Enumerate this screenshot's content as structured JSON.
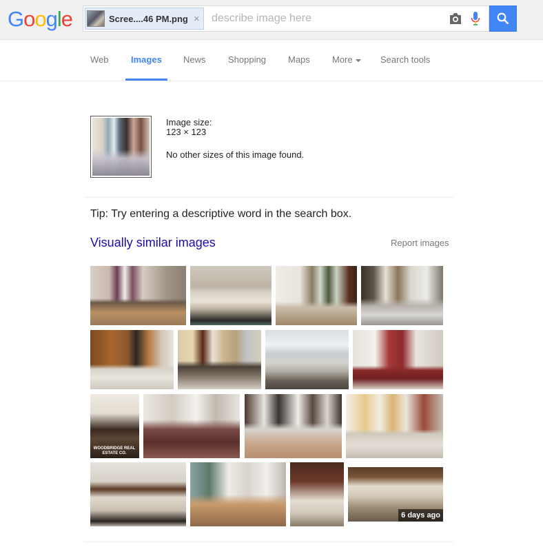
{
  "logo": {
    "text": "Google",
    "letters": [
      "G",
      "o",
      "o",
      "g",
      "l",
      "e"
    ],
    "colors": [
      "#4285f4",
      "#ea4335",
      "#fbbc05",
      "#4285f4",
      "#34a853",
      "#ea4335"
    ]
  },
  "search": {
    "chip_label": "Scree....46 PM.png",
    "chip_close": "×",
    "placeholder": "describe image here",
    "value": "",
    "camera_icon": "camera-icon",
    "mic_icon": "mic-icon",
    "search_icon": "search-icon",
    "accent": "#4285f4"
  },
  "tabs": [
    {
      "label": "Web",
      "active": false
    },
    {
      "label": "Images",
      "active": true
    },
    {
      "label": "News",
      "active": false
    },
    {
      "label": "Shopping",
      "active": false
    },
    {
      "label": "Maps",
      "active": false
    },
    {
      "label": "More",
      "active": false
    },
    {
      "label": "Search tools",
      "active": false
    }
  ],
  "query_image": {
    "size_label": "Image size:",
    "size_value": "123 × 123",
    "no_sizes": "No other sizes of this image found."
  },
  "tip": "Tip: Try entering a descriptive word in the search box.",
  "similar": {
    "title": "Visually similar images",
    "report": "Report images",
    "thumbnails": [
      {
        "desc": "dining room with purple curtains"
      },
      {
        "desc": "living room with beige sofas"
      },
      {
        "desc": "living room with wood floors"
      },
      {
        "desc": "living room with grey sofas"
      },
      {
        "desc": "wood paneled dining room"
      },
      {
        "desc": "kitchen with island and stool"
      },
      {
        "desc": "sunroom with windows"
      },
      {
        "desc": "living room with brick fireplace"
      },
      {
        "desc": "entry hall with staircase",
        "watermark": "WOODBRIDGE REAL ESTATE CO."
      },
      {
        "desc": "kitchen renovation"
      },
      {
        "desc": "kitchen with bar stools"
      },
      {
        "desc": "living room with yellow drapes"
      },
      {
        "desc": "open hall with railing"
      },
      {
        "desc": "dining table by window"
      },
      {
        "desc": "foyer with front door"
      },
      {
        "desc": "large room with wood ceiling",
        "badge": "6 days ago"
      }
    ]
  }
}
